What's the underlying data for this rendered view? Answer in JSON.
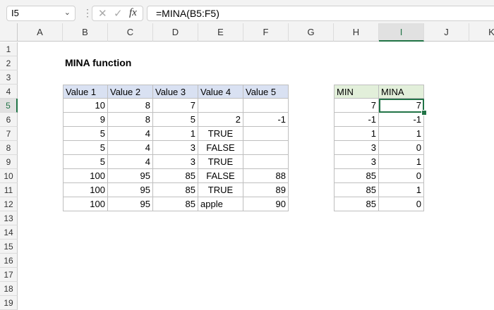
{
  "name_box": "I5",
  "formula": "=MINA(B5:F5)",
  "fx_label": "fx",
  "columns": [
    "A",
    "B",
    "C",
    "D",
    "E",
    "F",
    "G",
    "H",
    "I",
    "J",
    "K"
  ],
  "rows": [
    "1",
    "2",
    "3",
    "4",
    "5",
    "6",
    "7",
    "8",
    "9",
    "10",
    "11",
    "12",
    "13",
    "14",
    "15",
    "16",
    "17",
    "18",
    "19"
  ],
  "selected_cell": {
    "col": "I",
    "row": "5"
  },
  "title": "MINA function",
  "table1": {
    "headers": [
      "Value 1",
      "Value 2",
      "Value 3",
      "Value 4",
      "Value 5"
    ],
    "rows": [
      [
        "10",
        "8",
        "7",
        "",
        ""
      ],
      [
        "9",
        "8",
        "5",
        "2",
        "-1"
      ],
      [
        "5",
        "4",
        "1",
        "TRUE",
        ""
      ],
      [
        "5",
        "4",
        "3",
        "FALSE",
        ""
      ],
      [
        "5",
        "4",
        "3",
        "TRUE",
        ""
      ],
      [
        "100",
        "95",
        "85",
        "FALSE",
        "88"
      ],
      [
        "100",
        "95",
        "85",
        "TRUE",
        "89"
      ],
      [
        "100",
        "95",
        "85",
        "apple",
        "90"
      ]
    ]
  },
  "table2": {
    "headers": [
      "MIN",
      "MINA"
    ],
    "rows": [
      [
        "7",
        "7"
      ],
      [
        "-1",
        "-1"
      ],
      [
        "1",
        "1"
      ],
      [
        "3",
        "0"
      ],
      [
        "3",
        "1"
      ],
      [
        "85",
        "0"
      ],
      [
        "85",
        "1"
      ],
      [
        "85",
        "0"
      ]
    ]
  }
}
